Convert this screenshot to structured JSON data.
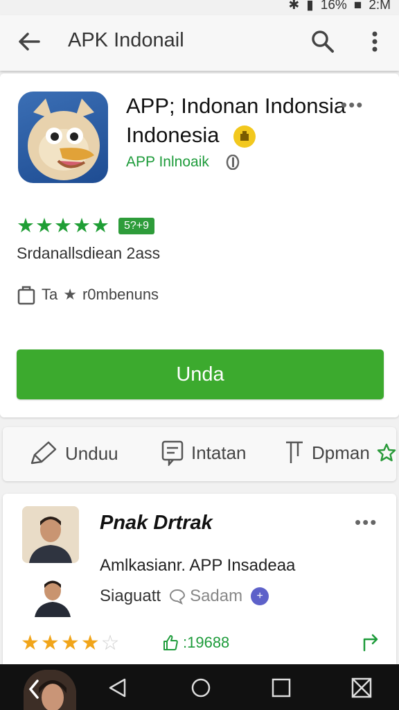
{
  "status_bar": {
    "battery": "16%",
    "time": "2:M"
  },
  "app_bar": {
    "title": "APK Indonail"
  },
  "app": {
    "name": "APP; Indonan Indonsia Indonesia",
    "developer": "APP Inlnoaik",
    "more": "•••",
    "rating_badge": "5?+9",
    "subtitle": "Srdanallsdiean 2ass",
    "category": "Ta",
    "category_rest": "r0mbenuns",
    "install_label": "Unda"
  },
  "actions": [
    {
      "label": "Unduu"
    },
    {
      "label": "Intatan"
    },
    {
      "label": "Dpman"
    }
  ],
  "review": {
    "reviewer": "Pnak Drtrak",
    "more": "•••",
    "text": "Amlkasianr. APP Insadeaa",
    "meta_label": "Siaguatt",
    "chat_label": "Sadam",
    "likes": ":19688",
    "stars_filled": 4,
    "stars_total": 5
  },
  "colors": {
    "accent_green": "#3caa2e",
    "rating_green": "#1f9e35",
    "star_orange": "#f1a51a"
  },
  "icons": [
    "back-arrow-icon",
    "search-icon",
    "more-vert-icon",
    "pencil-icon",
    "note-icon",
    "bookmark-icon",
    "star-outline-icon",
    "thumbs-up-icon",
    "share-icon"
  ]
}
